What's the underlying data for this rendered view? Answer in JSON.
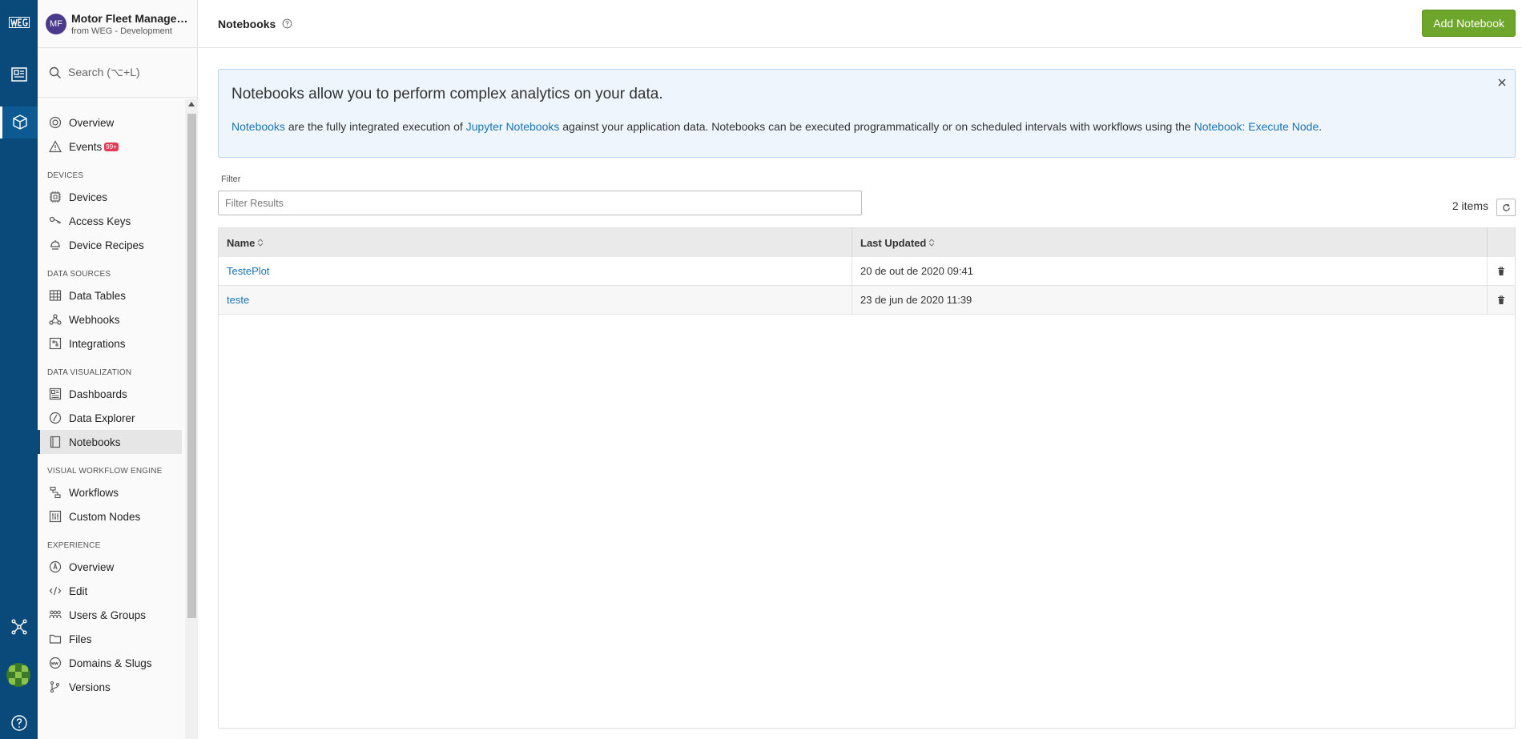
{
  "app": {
    "avatar_initials": "MF",
    "title": "Motor Fleet Manageme...",
    "subtitle": "from WEG - Development"
  },
  "search": {
    "placeholder": "Search (⌥+L)"
  },
  "nav": {
    "overview": "Overview",
    "events": "Events",
    "events_badge": "99+",
    "sections": {
      "devices": "DEVICES",
      "data_sources": "DATA SOURCES",
      "data_visualization": "DATA VISUALIZATION",
      "workflow": "VISUAL WORKFLOW ENGINE",
      "experience": "EXPERIENCE"
    },
    "devices": "Devices",
    "access_keys": "Access Keys",
    "device_recipes": "Device Recipes",
    "data_tables": "Data Tables",
    "webhooks": "Webhooks",
    "integrations": "Integrations",
    "dashboards": "Dashboards",
    "data_explorer": "Data Explorer",
    "notebooks": "Notebooks",
    "workflows": "Workflows",
    "custom_nodes": "Custom Nodes",
    "exp_overview": "Overview",
    "edit": "Edit",
    "users_groups": "Users & Groups",
    "files": "Files",
    "domains_slugs": "Domains & Slugs",
    "versions": "Versions"
  },
  "page": {
    "title": "Notebooks",
    "add_button": "Add Notebook"
  },
  "info": {
    "heading": "Notebooks allow you to perform complex analytics on your data.",
    "link1": "Notebooks",
    "text1": " are the fully integrated execution of ",
    "link2": "Jupyter Notebooks",
    "text2": " against your application data. Notebooks can be executed programmatically or on scheduled intervals with workflows using the ",
    "link3": "Notebook: Execute Node",
    "text3": "."
  },
  "filter": {
    "label": "Filter",
    "placeholder": "Filter Results",
    "value": ""
  },
  "items_count": "2 items",
  "table": {
    "headers": {
      "name": "Name",
      "last_updated": "Last Updated"
    },
    "rows": [
      {
        "name": "TestePlot",
        "last_updated": "20 de out de 2020 09:41"
      },
      {
        "name": "teste",
        "last_updated": "23 de jun de 2020 11:39"
      }
    ]
  },
  "colors": {
    "rail": "#0a4a7a",
    "accent_button": "#6da62b",
    "link": "#1a73b6",
    "badge": "#e23b57"
  }
}
